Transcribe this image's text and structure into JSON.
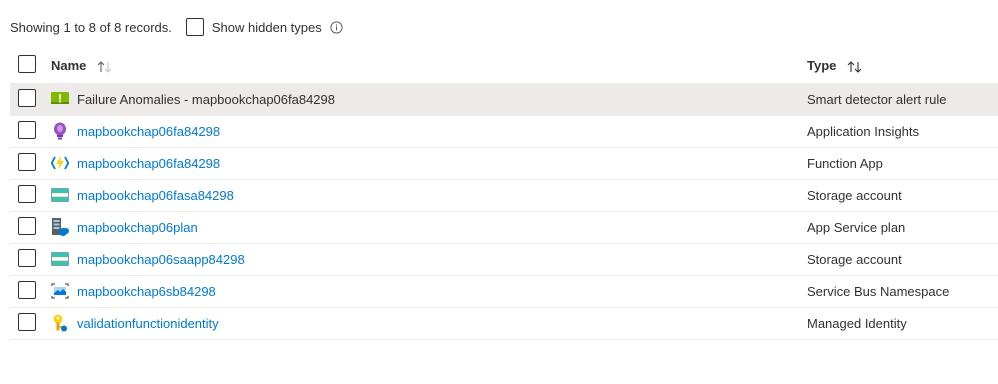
{
  "summary": {
    "records_text": "Showing 1 to 8 of 8 records."
  },
  "filter": {
    "show_hidden_label": "Show hidden types",
    "show_hidden_checked": false
  },
  "table": {
    "columns": [
      {
        "label": "Name",
        "sort": "ascending"
      },
      {
        "label": "Type",
        "sort": "sortable"
      }
    ],
    "rows": [
      {
        "name": "Failure Anomalies - mapbookchap06fa84298",
        "type": "Smart detector alert rule",
        "icon": "smart-detector-icon",
        "selected": true
      },
      {
        "name": "mapbookchap06fa84298",
        "type": "Application Insights",
        "icon": "application-insights-icon",
        "selected": false
      },
      {
        "name": "mapbookchap06fa84298",
        "type": "Function App",
        "icon": "function-app-icon",
        "selected": false
      },
      {
        "name": "mapbookchap06fasa84298",
        "type": "Storage account",
        "icon": "storage-account-icon",
        "selected": false
      },
      {
        "name": "mapbookchap06plan",
        "type": "App Service plan",
        "icon": "app-service-plan-icon",
        "selected": false
      },
      {
        "name": "mapbookchap06saapp84298",
        "type": "Storage account",
        "icon": "storage-account-icon",
        "selected": false
      },
      {
        "name": "mapbookchap6sb84298",
        "type": "Service Bus Namespace",
        "icon": "service-bus-icon",
        "selected": false
      },
      {
        "name": "validationfunctionidentity",
        "type": "Managed Identity",
        "icon": "managed-identity-icon",
        "selected": false
      }
    ]
  },
  "colors": {
    "link": "#0078d4",
    "text": "#323130",
    "selected_row": "#edebe9",
    "border": "#edebe9"
  }
}
